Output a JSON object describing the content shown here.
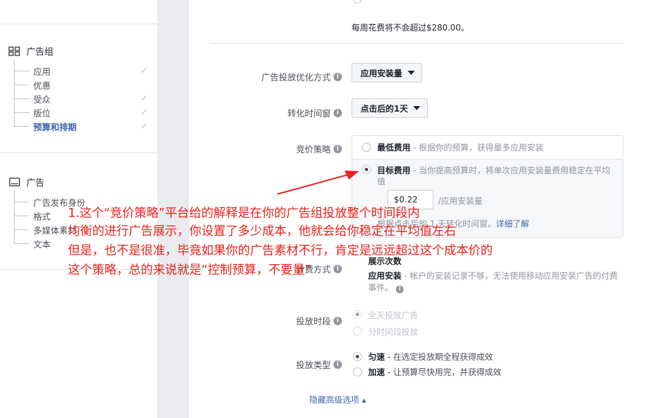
{
  "leftnav": {
    "adset_heading": "广告组",
    "adset_items": [
      {
        "label": "应用",
        "checked": true
      },
      {
        "label": "优惠",
        "checked": false
      },
      {
        "label": "受众",
        "checked": true
      },
      {
        "label": "版位",
        "checked": true
      },
      {
        "label": "预算和排期",
        "checked": true,
        "active": true
      }
    ],
    "ad_heading": "广告",
    "ad_items": [
      {
        "label": "广告发布身份"
      },
      {
        "label": "格式"
      },
      {
        "label": "多媒体素材"
      },
      {
        "label": "文本"
      }
    ]
  },
  "main": {
    "weekly_note": "每周花费将不会超过$280.00。",
    "optimization": {
      "label": "广告投放优化方式",
      "value": "应用安装量"
    },
    "conversion_window": {
      "label": "转化时间窗",
      "value": "点击后的1天"
    },
    "bid_strategy": {
      "label": "竞价策略",
      "lowest_cost": {
        "title": "最低费用",
        "desc": " - 根据你的预算，获得最多应用安装"
      },
      "target_cost": {
        "title": "目标费用",
        "desc_line1": " - 当你提高预算时，将单次应用安装量费用稳定在平均",
        "desc_line2": "值",
        "input_value": "$0.22",
        "unit": "/应用安装量",
        "note": "根据点击后的 1 天转化时间窗。",
        "learn_more": "详细了解"
      }
    },
    "billing": {
      "label": "计费方式",
      "impressions": "展示次数",
      "app_install_title": "应用安装",
      "app_install_desc_line1": " - 帐户的安装记录不够，无法使用移动应用安装广告的付费",
      "app_install_desc_line2": "事件。"
    },
    "schedule": {
      "label": "投放时段",
      "all_day": "全天投放广告",
      "custom": "分时间段投放"
    },
    "delivery_type": {
      "label": "投放类型",
      "standard_title": "匀速",
      "standard_desc": " - 在选定投放期全程获得成效",
      "accelerated_title": "加速",
      "accelerated_desc": " - 让预算尽快用完，并获得成效"
    },
    "hide_advanced": "隐藏高级选项 ▴"
  },
  "annotation": {
    "line1": "1.这个“竞价策略”平台给的解释是在你的广告组投放整个时间段内",
    "line2": "均衡的进行广告展示，你设置了多少成本，他就会给你稳定在平均值左右",
    "line3": "但是，也不是很准，毕竟如果你的广告素材不行，肯定是远远超过这个成本价的",
    "line4": "这个策略，总的来说就是“控制预算，不要量”",
    "color": "#e8221b"
  },
  "colors": {
    "accent": "#4267b2",
    "muted": "#90949c",
    "border": "#dddfe2"
  }
}
